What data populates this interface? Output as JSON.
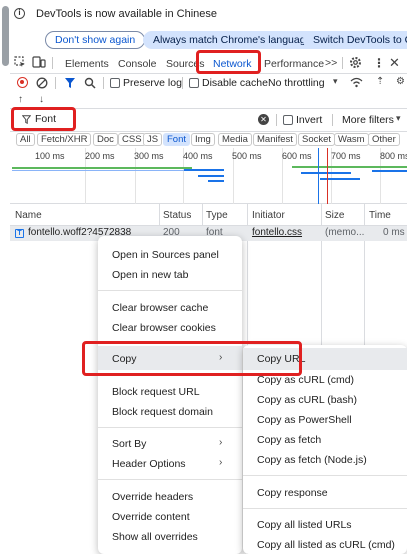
{
  "infobar": {
    "message": "DevTools is now available in Chinese",
    "btn_dont_show": "Don't show again",
    "btn_match_lang": "Always match Chrome's language",
    "btn_switch": "Switch DevTools to Chi"
  },
  "tabs": {
    "elements": "Elements",
    "console": "Console",
    "sources": "Sources",
    "network": "Network",
    "performance": "Performance",
    "more": ">>"
  },
  "toolbar": {
    "preserve_log": "Preserve log",
    "disable_cache": "Disable cache",
    "throttling": "No throttling"
  },
  "filter": {
    "value": "Font",
    "invert": "Invert",
    "more_filters": "More filters"
  },
  "types": [
    "All",
    "Fetch/XHR",
    "Doc",
    "CSS",
    "JS",
    "Font",
    "Img",
    "Media",
    "Manifest",
    "Socket",
    "Wasm",
    "Other"
  ],
  "timeline_labels": [
    "100 ms",
    "200 ms",
    "300 ms",
    "400 ms",
    "500 ms",
    "600 ms",
    "700 ms",
    "800 ms"
  ],
  "table": {
    "headers": {
      "name": "Name",
      "status": "Status",
      "type": "Type",
      "initiator": "Initiator",
      "size": "Size",
      "time": "Time"
    },
    "row": {
      "name": "fontello.woff2?4572838",
      "status": "200",
      "type": "font",
      "initiator": "fontello.css",
      "size": "(memo...",
      "time": "0 ms"
    }
  },
  "menu": {
    "open_sources": "Open in Sources panel",
    "open_tab": "Open in new tab",
    "clear_cache": "Clear browser cache",
    "clear_cookies": "Clear browser cookies",
    "copy": "Copy",
    "block_url": "Block request URL",
    "block_domain": "Block request domain",
    "sort_by": "Sort By",
    "header_options": "Header Options",
    "override_headers": "Override headers",
    "override_content": "Override content",
    "show_overrides": "Show all overrides"
  },
  "submenu": {
    "copy_url": "Copy URL",
    "copy_curl_cmd": "Copy as cURL (cmd)",
    "copy_curl_bash": "Copy as cURL (bash)",
    "copy_powershell": "Copy as PowerShell",
    "copy_fetch": "Copy as fetch",
    "copy_fetch_node": "Copy as fetch (Node.js)",
    "copy_response": "Copy response",
    "copy_all_urls": "Copy all listed URLs",
    "copy_all_curl_cmd": "Copy all listed as cURL (cmd)"
  },
  "colors": {
    "accent": "#0b57d0",
    "highlight": "#e02020",
    "record": "#d93025"
  }
}
